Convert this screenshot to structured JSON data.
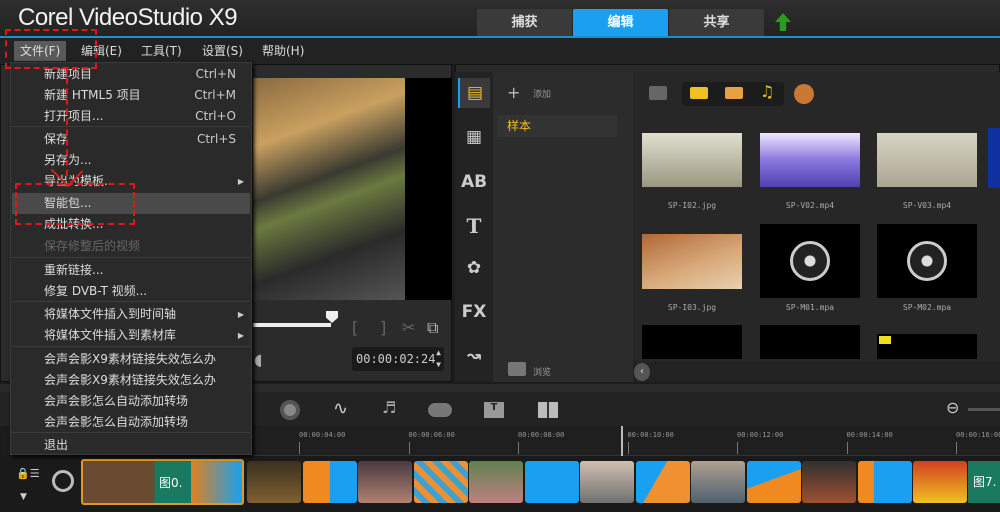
{
  "app": {
    "title": "Corel VideoStudio X9"
  },
  "tabs": [
    {
      "label": "捕获"
    },
    {
      "label": "编辑",
      "active": true
    },
    {
      "label": "共享"
    }
  ],
  "menubar": [
    {
      "label": "文件(F)",
      "open": true
    },
    {
      "label": "编辑(E)"
    },
    {
      "label": "工具(T)"
    },
    {
      "label": "设置(S)"
    },
    {
      "label": "帮助(H)"
    }
  ],
  "file_menu": [
    {
      "label": "新建项目",
      "shortcut": "Ctrl+N"
    },
    {
      "label": "新建 HTML5 项目",
      "shortcut": "Ctrl+M"
    },
    {
      "label": "打开项目...",
      "shortcut": "Ctrl+O"
    },
    {
      "label": "保存",
      "shortcut": "Ctrl+S"
    },
    {
      "label": "另存为..."
    },
    {
      "label": "导出为模板...",
      "submenu": true
    },
    {
      "label": "智能包...",
      "highlighted": true
    },
    {
      "label": "成批转换..."
    },
    {
      "label": "保存修整后的视频",
      "disabled": true
    },
    {
      "label": "重新链接..."
    },
    {
      "label": "修复 DVB-T 视频..."
    },
    {
      "label": "将媒体文件插入到时间轴",
      "submenu": true
    },
    {
      "label": "将媒体文件插入到素材库",
      "submenu": true
    },
    {
      "label": "会声会影X9素材链接失效怎么办"
    },
    {
      "label": "会声会影X9素材链接失效怎么办"
    },
    {
      "label": "会声会影怎么自动添加转场"
    },
    {
      "label": "会声会影怎么自动添加转场"
    },
    {
      "label": "退出"
    }
  ],
  "preview": {
    "timecode": "00:00:02:24",
    "progress": 0.3
  },
  "library": {
    "add_label": "添加",
    "folder": "样本",
    "browse_label": "浏览",
    "items": [
      {
        "name": "SP-I02.jpg"
      },
      {
        "name": "SP-V02.mp4"
      },
      {
        "name": "SP-V03.mp4"
      },
      {
        "name": "SP-I03.jpg"
      },
      {
        "name": "SP-M01.mpa"
      },
      {
        "name": "SP-M02.mpa"
      }
    ]
  },
  "timeline": {
    "ticks": [
      "00:00:04:00",
      "00:00:06:00",
      "00:00:08:00",
      "00:00:10:00",
      "00:00:12:00",
      "00:00:14:00",
      "00:00:16:00"
    ],
    "clip_first_label": "图0.",
    "clip_last_label": "图7."
  },
  "colors": {
    "accent": "#1aa0f0",
    "annotation": "#e01818",
    "highlight_text": "#f0c020"
  }
}
